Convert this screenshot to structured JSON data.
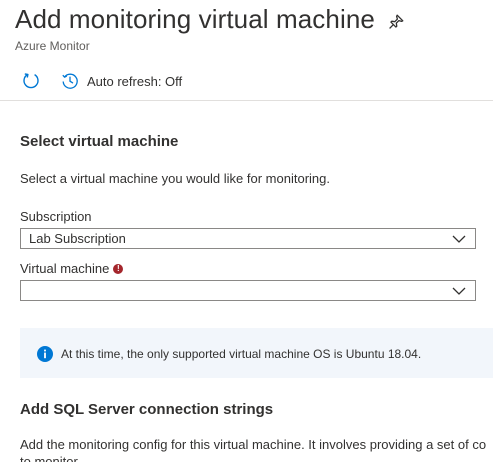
{
  "header": {
    "title": "Add monitoring virtual machine",
    "subtitle": "Azure Monitor",
    "pin_icon": "pin-icon"
  },
  "toolbar": {
    "refresh_icon": "refresh-icon",
    "auto_refresh_icon": "history-clock-icon",
    "auto_refresh_label": "Auto refresh: Off"
  },
  "select_vm": {
    "title": "Select virtual machine",
    "description": "Select a virtual machine you would like for monitoring.",
    "subscription": {
      "label": "Subscription",
      "value": "Lab Subscription"
    },
    "virtual_machine": {
      "label": "Virtual machine",
      "required_mark": "!",
      "value": ""
    }
  },
  "info": {
    "icon": "info-icon",
    "text": "At this time, the only supported virtual machine OS is Ubuntu 18.04."
  },
  "sql": {
    "title": "Add SQL Server connection strings",
    "description": "Add the monitoring config for this virtual machine. It involves providing a set of co",
    "description_cont": "to monitor."
  },
  "colors": {
    "accent": "#0078d4",
    "required": "#a4262c",
    "info_bg": "#f2f6fb",
    "border": "#8a8886"
  }
}
